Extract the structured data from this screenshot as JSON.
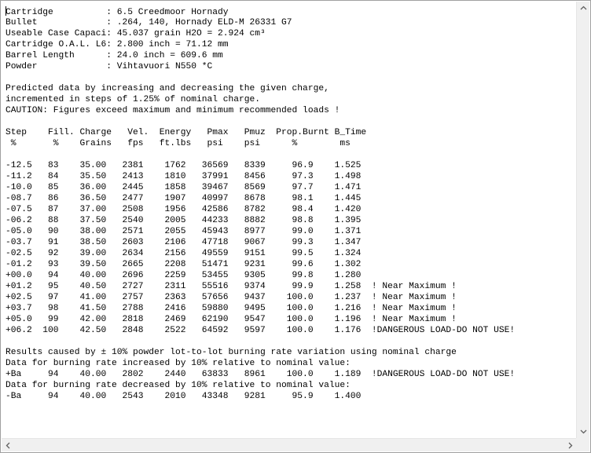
{
  "lines": [
    "Cartridge          : 6.5 Creedmoor Hornady",
    "Bullet             : .264, 140, Hornady ELD-M 26331 G7",
    "Useable Case Capaci: 45.037 grain H2O = 2.924 cm³",
    "Cartridge O.A.L. L6: 2.800 inch = 71.12 mm",
    "Barrel Length      : 24.0 inch = 609.6 mm",
    "Powder             : Vihtavuori N550 *C",
    "",
    "Predicted data by increasing and decreasing the given charge,",
    "incremented in steps of 1.25% of nominal charge.",
    "CAUTION: Figures exceed maximum and minimum recommended loads !",
    "",
    "Step    Fill. Charge   Vel.  Energy   Pmax   Pmuz  Prop.Burnt B_Time",
    " %       %    Grains   fps   ft.lbs   psi    psi      %        ms",
    "",
    "-12.5   83    35.00   2381    1762   36569   8339     96.9    1.525",
    "-11.2   84    35.50   2413    1810   37991   8456     97.3    1.498",
    "-10.0   85    36.00   2445    1858   39467   8569     97.7    1.471",
    "-08.7   86    36.50   2477    1907   40997   8678     98.1    1.445",
    "-07.5   87    37.00   2508    1956   42586   8782     98.4    1.420",
    "-06.2   88    37.50   2540    2005   44233   8882     98.8    1.395",
    "-05.0   90    38.00   2571    2055   45943   8977     99.0    1.371",
    "-03.7   91    38.50   2603    2106   47718   9067     99.3    1.347",
    "-02.5   92    39.00   2634    2156   49559   9151     99.5    1.324",
    "-01.2   93    39.50   2665    2208   51471   9231     99.6    1.302",
    "+00.0   94    40.00   2696    2259   53455   9305     99.8    1.280",
    "+01.2   95    40.50   2727    2311   55516   9374     99.9    1.258  ! Near Maximum !",
    "+02.5   97    41.00   2757    2363   57656   9437    100.0    1.237  ! Near Maximum !",
    "+03.7   98    41.50   2788    2416   59880   9495    100.0    1.216  ! Near Maximum !",
    "+05.0   99    42.00   2818    2469   62190   9547    100.0    1.196  ! Near Maximum !",
    "+06.2  100    42.50   2848    2522   64592   9597    100.0    1.176  !DANGEROUS LOAD-DO NOT USE!",
    "",
    "Results caused by ± 10% powder lot-to-lot burning rate variation using nominal charge",
    "Data for burning rate increased by 10% relative to nominal value:",
    "+Ba     94    40.00   2802    2440   63833   8961    100.0    1.189  !DANGEROUS LOAD-DO NOT USE!",
    "Data for burning rate decreased by 10% relative to nominal value:",
    "-Ba     94    40.00   2543    2010   43348   9281     95.9    1.400"
  ]
}
